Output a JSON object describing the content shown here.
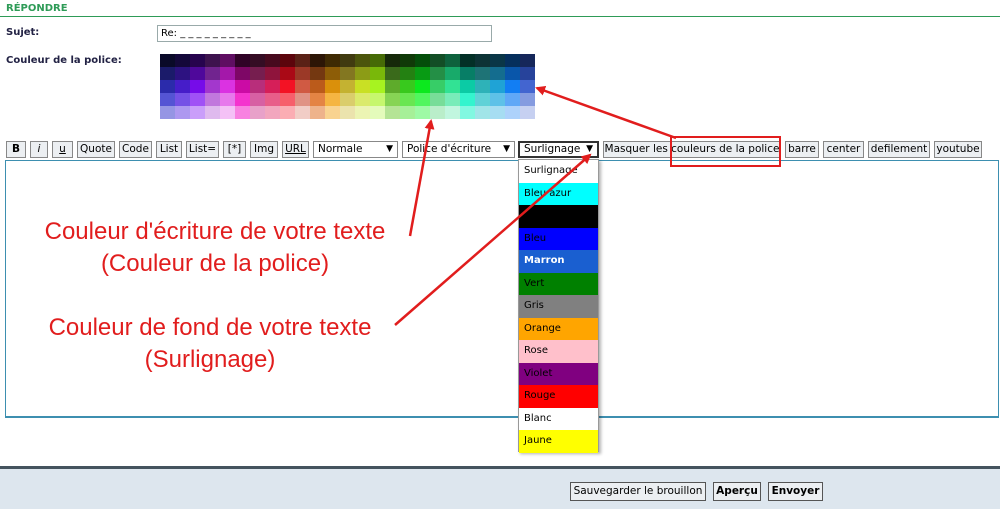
{
  "header": {
    "title": "RÉPONDRE"
  },
  "form": {
    "subject_label": "Sujet:",
    "subject_value": "Re: _ _ _ _ _ _ _ _ _",
    "color_label": "Couleur de la police:"
  },
  "palette": {
    "rows": 5,
    "cols": 25
  },
  "toolbar": {
    "bold": "B",
    "italic": "i",
    "underline": "u",
    "quote": "Quote",
    "code": "Code",
    "list": "List",
    "list_ordered": "List=",
    "list_item": "[*]",
    "img": "Img",
    "url": "URL",
    "size_select": "Normale",
    "font_select": "Police d'écriture",
    "highlight_select": "Surlignage",
    "toggle_colors": "Masquer les couleurs de la police",
    "barre": "barre",
    "center": "center",
    "defilement": "defilement",
    "youtube": "youtube"
  },
  "highlight_options": [
    {
      "label": "Surlignage",
      "bg": "#ffffff",
      "fg": "#000000"
    },
    {
      "label": "Bleu azur",
      "bg": "#00ffff",
      "fg": "#000000"
    },
    {
      "label": "Noir",
      "bg": "#000000",
      "fg": "#000000"
    },
    {
      "label": "Bleu",
      "bg": "#0000ff",
      "fg": "#000000"
    },
    {
      "label": "Marron",
      "bg": "#1a5fd0",
      "fg": "#ffffff"
    },
    {
      "label": "Vert",
      "bg": "#008000",
      "fg": "#000000"
    },
    {
      "label": "Gris",
      "bg": "#808080",
      "fg": "#000000"
    },
    {
      "label": "Orange",
      "bg": "#ffa500",
      "fg": "#000000"
    },
    {
      "label": "Rose",
      "bg": "#ffc0cb",
      "fg": "#000000"
    },
    {
      "label": "Violet",
      "bg": "#800080",
      "fg": "#000000"
    },
    {
      "label": "Rouge",
      "bg": "#ff0000",
      "fg": "#000000"
    },
    {
      "label": "Blanc",
      "bg": "#ffffff",
      "fg": "#000000"
    },
    {
      "label": "Jaune",
      "bg": "#ffff00",
      "fg": "#000000"
    }
  ],
  "footer": {
    "save_draft": "Sauvegarder le brouillon",
    "preview": "Aperçu",
    "send": "Envoyer"
  },
  "annotations": {
    "text_color_line1": "Couleur d'écriture de votre texte",
    "text_color_line2": "(Couleur de la police)",
    "bg_color_line1": "Couleur de fond de votre texte",
    "bg_color_line2": "(Surlignage)"
  },
  "colors": {
    "accent_green": "#2e9b57",
    "annotation_red": "#e11d1d",
    "editor_border": "#3d8fb0"
  }
}
